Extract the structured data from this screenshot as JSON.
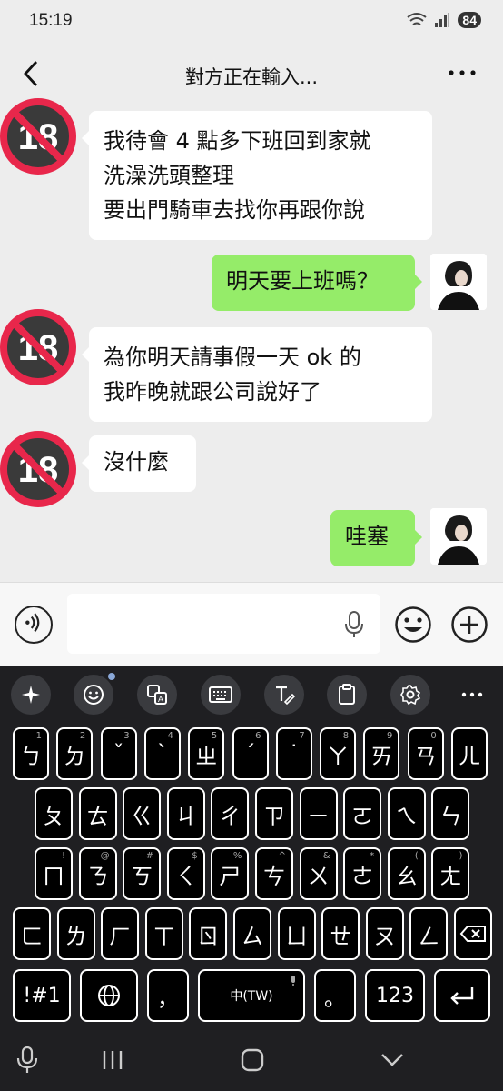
{
  "status": {
    "time": "15:19",
    "battery": "84"
  },
  "header": {
    "title": "對方正在輸入..."
  },
  "messages": [
    {
      "side": "left",
      "text": "我待會 4 點多下班回到家就\n洗澡洗頭整理\n要出門騎車去找你再跟你說"
    },
    {
      "side": "right",
      "text": "明天要上班嗎？"
    },
    {
      "side": "left",
      "text": "為你明天請事假一天 ok 的\n我昨晚就跟公司說好了"
    },
    {
      "side": "left",
      "text": "沒什麼"
    },
    {
      "side": "right",
      "text": "哇塞"
    }
  ],
  "avatar_badge": "18",
  "input": {
    "value": "",
    "placeholder": ""
  },
  "keyboard": {
    "row1": [
      {
        "k": "ㄅ",
        "h": "1"
      },
      {
        "k": "ㄉ",
        "h": "2"
      },
      {
        "k": "ˇ",
        "h": "3"
      },
      {
        "k": "ˋ",
        "h": "4"
      },
      {
        "k": "ㄓ",
        "h": "5"
      },
      {
        "k": "ˊ",
        "h": "6"
      },
      {
        "k": "˙",
        "h": "7"
      },
      {
        "k": "ㄚ",
        "h": "8"
      },
      {
        "k": "ㄞ",
        "h": "9"
      },
      {
        "k": "ㄢ",
        "h": "0"
      },
      {
        "k": "ㄦ",
        "h": ""
      }
    ],
    "row2": [
      {
        "k": "ㄆ",
        "h": ""
      },
      {
        "k": "ㄊ",
        "h": ""
      },
      {
        "k": "ㄍ",
        "h": ""
      },
      {
        "k": "ㄐ",
        "h": ""
      },
      {
        "k": "ㄔ",
        "h": ""
      },
      {
        "k": "ㄗ",
        "h": ""
      },
      {
        "k": "ㄧ",
        "h": ""
      },
      {
        "k": "ㄛ",
        "h": ""
      },
      {
        "k": "ㄟ",
        "h": ""
      },
      {
        "k": "ㄣ",
        "h": ""
      }
    ],
    "row3": [
      {
        "k": "ㄇ",
        "h": "!"
      },
      {
        "k": "ㄋ",
        "h": "@"
      },
      {
        "k": "ㄎ",
        "h": "#"
      },
      {
        "k": "ㄑ",
        "h": "$"
      },
      {
        "k": "ㄕ",
        "h": "%"
      },
      {
        "k": "ㄘ",
        "h": "^"
      },
      {
        "k": "ㄨ",
        "h": "&"
      },
      {
        "k": "ㄜ",
        "h": "*"
      },
      {
        "k": "ㄠ",
        "h": "("
      },
      {
        "k": "ㄤ",
        "h": ")"
      }
    ],
    "row4": [
      {
        "k": "ㄈ",
        "h": ""
      },
      {
        "k": "ㄌ",
        "h": ""
      },
      {
        "k": "ㄏ",
        "h": ""
      },
      {
        "k": "ㄒ",
        "h": ""
      },
      {
        "k": "ㄖ",
        "h": ""
      },
      {
        "k": "ㄙ",
        "h": ""
      },
      {
        "k": "ㄩ",
        "h": ""
      },
      {
        "k": "ㄝ",
        "h": ""
      },
      {
        "k": "ㄡ",
        "h": ""
      },
      {
        "k": "ㄥ",
        "h": ""
      }
    ],
    "symbols_label": "!#1",
    "comma": "，",
    "space_label": "中(TW)",
    "period": "。",
    "numbers_label": "123"
  },
  "colors": {
    "self_bubble": "#95ec69",
    "keyboard_bg": "#1f1f22"
  }
}
